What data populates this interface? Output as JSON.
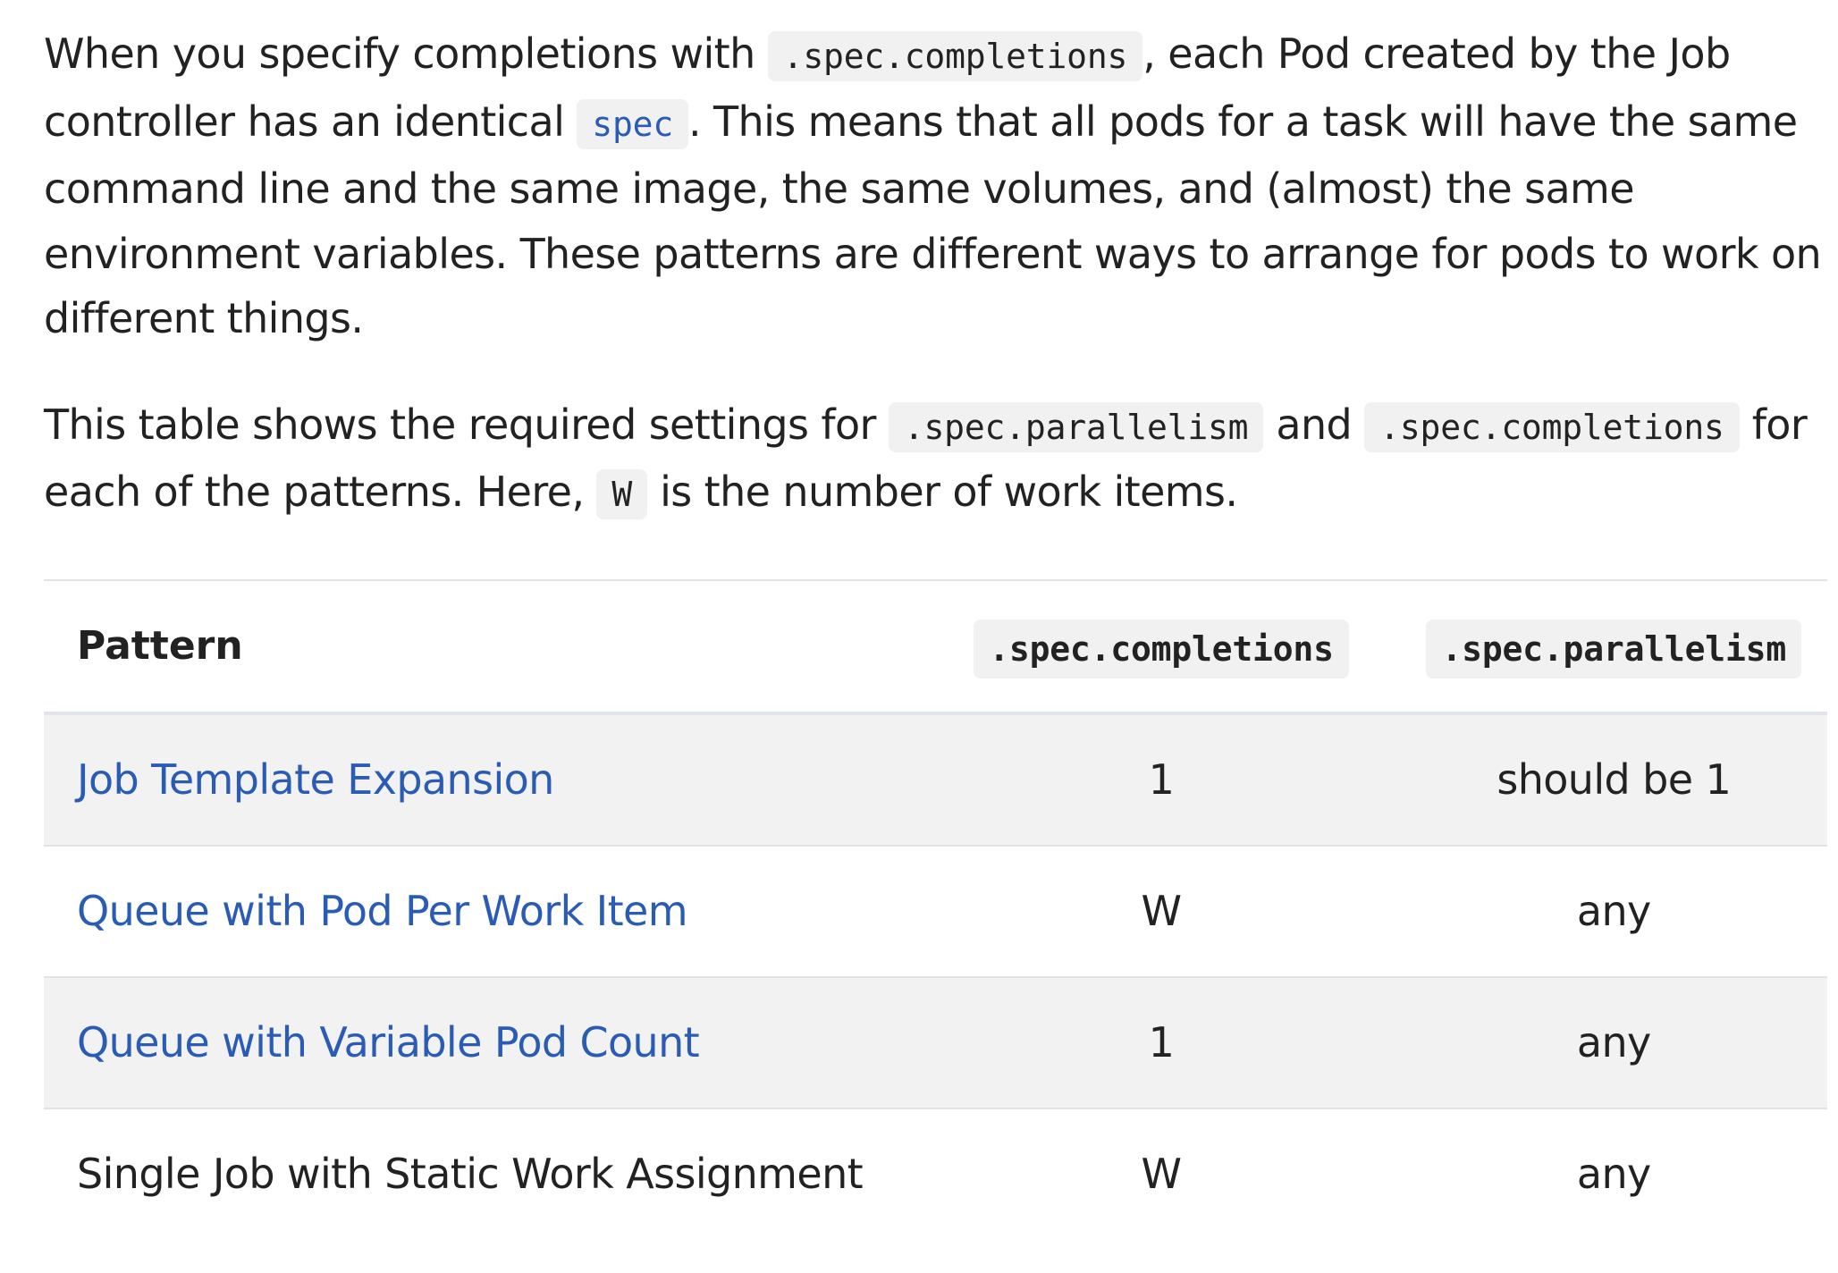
{
  "paragraph1": {
    "t1": "When you specify completions with ",
    "c1": ".spec.completions",
    "t2": ", each Pod created by the Job controller has an identical ",
    "c2": "spec",
    "t3": ". This means that all pods for a task will have the same command line and the same image, the same volumes, and (almost) the same environment variables. These patterns are different ways to arrange for pods to work on different things."
  },
  "paragraph2": {
    "t1": "This table shows the required settings for ",
    "c1": ".spec.parallelism",
    "t2": " and ",
    "c2": ".spec.completions",
    "t3": " for each of the patterns. Here, ",
    "c3": "W",
    "t4": " is the number of work items."
  },
  "table": {
    "headers": {
      "pattern": "Pattern",
      "completions": ".spec.completions",
      "parallelism": ".spec.parallelism"
    },
    "rows": [
      {
        "pattern": "Job Template Expansion",
        "completions": "1",
        "parallelism": "should be 1"
      },
      {
        "pattern": "Queue with Pod Per Work Item",
        "completions": "W",
        "parallelism": "any"
      },
      {
        "pattern": "Queue with Variable Pod Count",
        "completions": "1",
        "parallelism": "any"
      },
      {
        "pattern": "Single Job with Static Work Assignment",
        "completions": "W",
        "parallelism": "any"
      }
    ]
  },
  "colors": {
    "link": "#2a5bb5",
    "code_background": "#f1f1f1",
    "row_shade": "#f2f2f2",
    "text": "#222222"
  }
}
